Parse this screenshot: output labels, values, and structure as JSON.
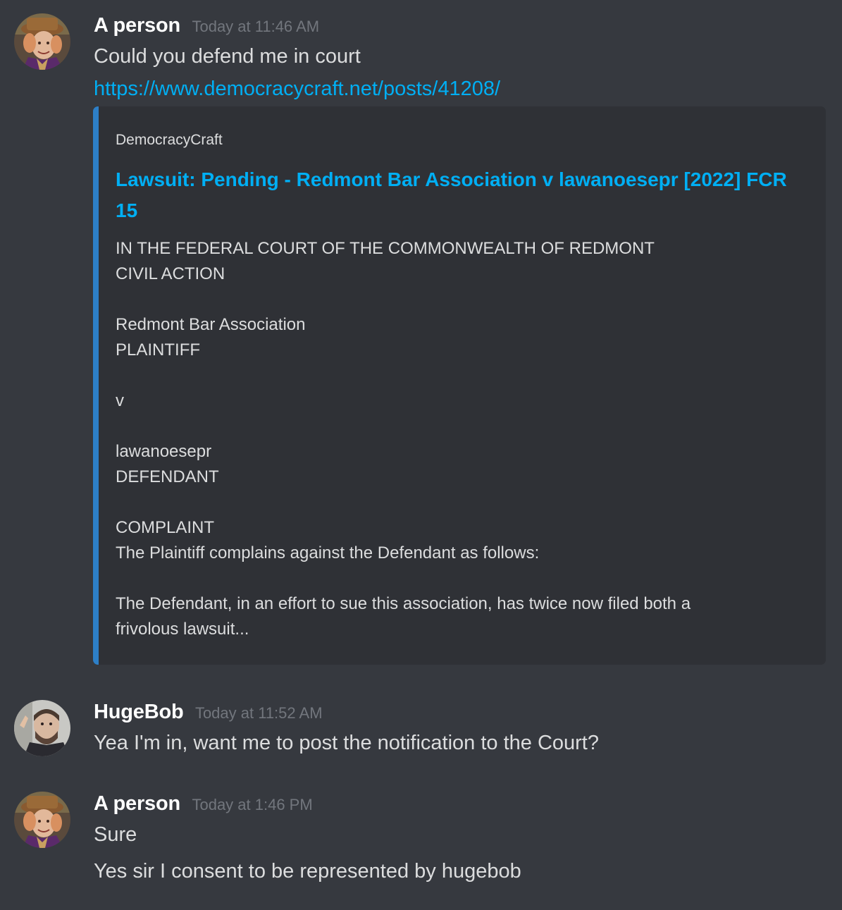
{
  "messages": [
    {
      "username": "A person",
      "timestamp": "Today at 11:46 AM",
      "lines": [
        "Could you defend me in court"
      ],
      "link": "https://www.democracycraft.net/posts/41208/",
      "embed": {
        "provider": "DemocracyCraft",
        "title": "Lawsuit: Pending - Redmont Bar Association v lawanoesepr [2022] FCR 15",
        "description": [
          "IN THE FEDERAL COURT OF THE COMMONWEALTH OF REDMONT",
          "CIVIL ACTION",
          "",
          "Redmont Bar Association",
          "PLAINTIFF",
          "",
          "v",
          "",
          "lawanoesepr",
          "DEFENDANT",
          "",
          "COMPLAINT",
          "The Plaintiff complains against the Defendant as follows:",
          "",
          "The Defendant, in an effort to sue this association, has twice now filed both a",
          "frivolous lawsuit..."
        ],
        "accent_color": "#2d7fc7"
      }
    },
    {
      "username": "HugeBob",
      "timestamp": "Today at 11:52 AM",
      "lines": [
        "Yea I'm in, want me to post the notification to the Court?"
      ]
    },
    {
      "username": "A person",
      "timestamp": "Today at 1:46 PM",
      "lines": [
        "Sure",
        "Yes sir I consent to be represented by hugebob"
      ]
    }
  ],
  "colors": {
    "background": "#36393f",
    "embed_background": "#2f3136",
    "link": "#00aff4",
    "text": "#dcddde",
    "timestamp": "#72767d"
  }
}
